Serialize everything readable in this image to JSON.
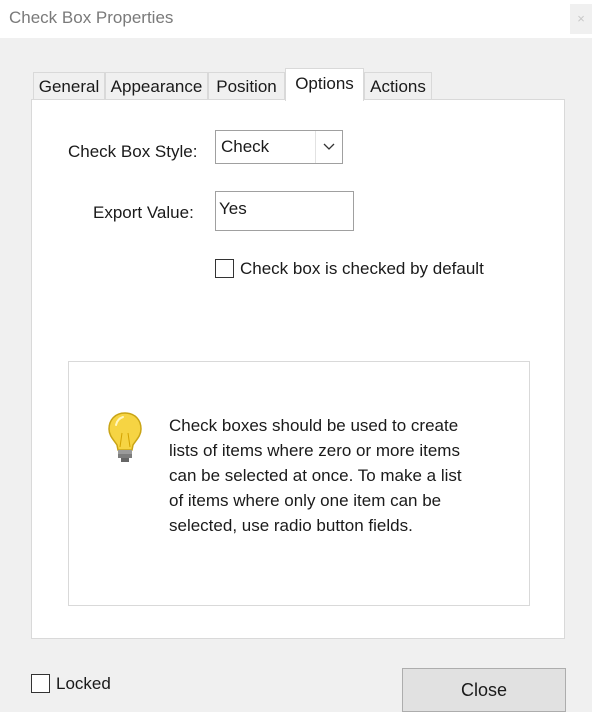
{
  "window": {
    "title": "Check Box Properties",
    "close_glyph": "×"
  },
  "tabs": [
    {
      "label": "General"
    },
    {
      "label": "Appearance"
    },
    {
      "label": "Position"
    },
    {
      "label": "Options",
      "active": true
    },
    {
      "label": "Actions"
    }
  ],
  "options": {
    "style_label": "Check Box Style:",
    "style_value": "Check",
    "export_label": "Export Value:",
    "export_value": "Yes",
    "default_checked_label": "Check box is checked by default",
    "default_checked": false
  },
  "info": {
    "icon": "lightbulb-icon",
    "lines": [
      "Check boxes should be used to create",
      "lists of items where zero or more items",
      "can be selected at once. To make a list",
      "of items where only one item can be",
      "selected, use radio button fields."
    ]
  },
  "footer": {
    "locked_label": "Locked",
    "locked": false,
    "close_label": "Close"
  },
  "colors": {
    "background": "#f0f0f0",
    "panel": "#ffffff",
    "bulb": "#f6d443",
    "button": "#e1e1e1"
  }
}
